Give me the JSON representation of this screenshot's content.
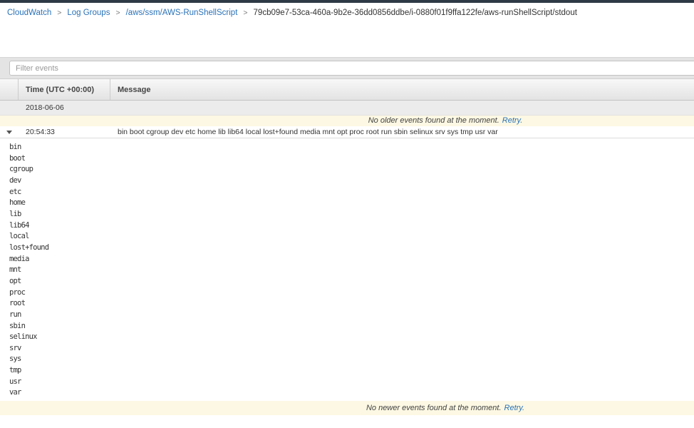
{
  "breadcrumb": {
    "separator": ">",
    "items": [
      {
        "label": "CloudWatch",
        "type": "link"
      },
      {
        "label": "Log Groups",
        "type": "link"
      },
      {
        "label": "/aws/ssm/AWS-RunShellScript",
        "type": "link"
      },
      {
        "label": "79cb09e7-53ca-460a-9b2e-36dd0856ddbe/i-0880f01f9ffa122fe/aws-runShellScript/stdout",
        "type": "text"
      }
    ]
  },
  "filter": {
    "placeholder": "Filter events"
  },
  "table": {
    "columns": {
      "time": "Time (UTC +00:00)",
      "message": "Message"
    },
    "date_row": "2018-06-06",
    "older_banner": {
      "text": "No older events found at the moment.",
      "retry_label": "Retry."
    },
    "event": {
      "time": "20:54:33",
      "message": "bin boot cgroup dev etc home lib lib64 local lost+found media mnt opt proc root run sbin selinux srv sys tmp usr var",
      "expanded_lines": [
        "bin",
        "boot",
        "cgroup",
        "dev",
        "etc",
        "home",
        "lib",
        "lib64",
        "local",
        "lost+found",
        "media",
        "mnt",
        "opt",
        "proc",
        "root",
        "run",
        "sbin",
        "selinux",
        "srv",
        "sys",
        "tmp",
        "usr",
        "var"
      ]
    },
    "newer_banner": {
      "text": "No newer events found at the moment.",
      "retry_label": "Retry."
    }
  },
  "colors": {
    "link_blue": "#2a72b8",
    "banner_yellow": "#fcf8e3",
    "topbar_dark": "#2e3a46"
  }
}
